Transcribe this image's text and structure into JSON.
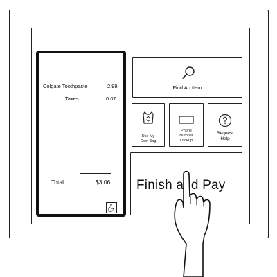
{
  "receipt": {
    "items": [
      {
        "name": "Colgate Toothpaste",
        "price": "2.99"
      },
      {
        "name": "Taxes",
        "price": "0.07"
      }
    ],
    "total_label": "Total",
    "total_value": "$3.06"
  },
  "tiles": {
    "find_item": {
      "label": "Find An Item",
      "icon": "magnifier-icon"
    },
    "own_bag": {
      "label_line1": "Use My",
      "label_line2": "Own Bag",
      "icon": "bag-icon"
    },
    "phone_lookup": {
      "label_line1": "Phone",
      "label_line2": "Number",
      "label_line3": "Lookup",
      "icon": "phone-icon"
    },
    "request_help": {
      "label_line1": "Request",
      "label_line2": "Help",
      "icon": "help-icon"
    },
    "finish_pay": {
      "label": "Finish and Pay"
    }
  },
  "accessibility": {
    "icon": "wheelchair-icon"
  }
}
